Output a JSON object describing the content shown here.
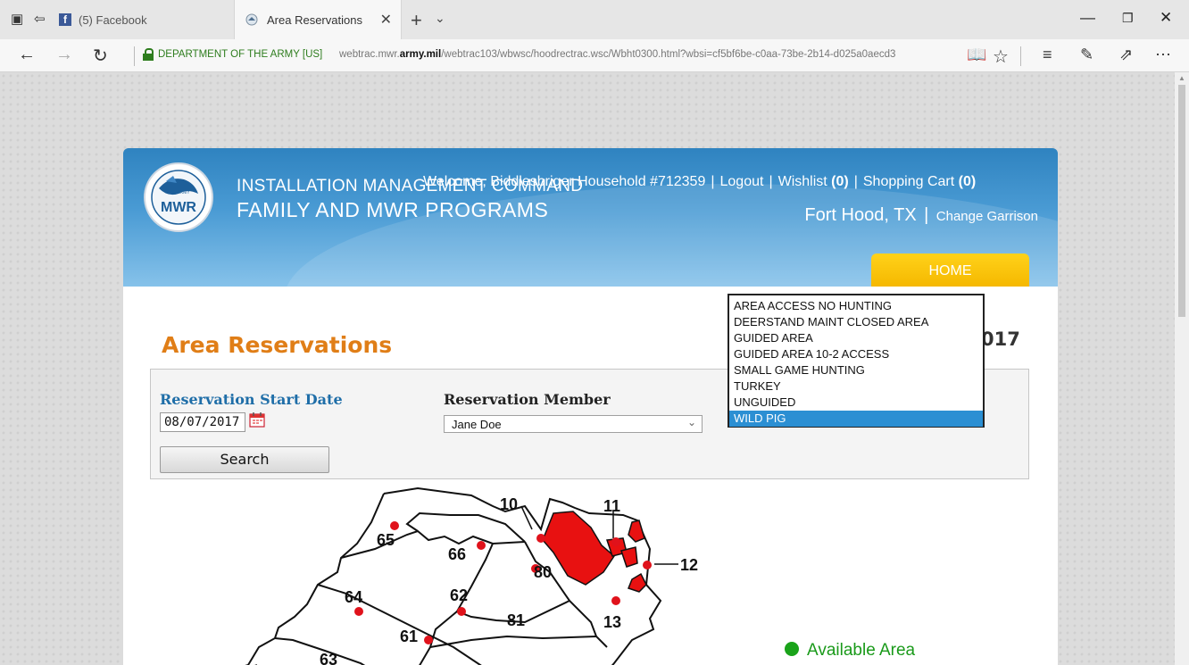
{
  "browser": {
    "tabs": [
      {
        "label": "(5) Facebook"
      },
      {
        "label": "Area Reservations"
      }
    ],
    "address": {
      "cert_name": "DEPARTMENT OF THE ARMY [US]",
      "url_prefix": "webtrac.mwr.",
      "url_domain": "army.mil",
      "url_suffix": "/webtrac103/wbwsc/hoodrectrac.wsc/Wbht0300.html?wbsi=cf5bf6be-c0aa-73be-2b14-d025a0aecd3"
    }
  },
  "header": {
    "logo_text": "MWR",
    "logo_small": "U.S. ARMY",
    "org_line1": "INSTALLATION MANAGEMENT COMMAND",
    "org_line2": "FAMILY AND MWR PROGRAMS",
    "welcome": "Welcome, Biddlesbriger Household #712359",
    "logout": "Logout",
    "wishlist": "Wishlist",
    "wishlist_count": "(0)",
    "cart": "Shopping Cart",
    "cart_count": "(0)",
    "location": "Fort Hood, TX",
    "change_garrison": "Change Garrison",
    "home_tab": "HOME"
  },
  "page": {
    "title": "Area Reservations",
    "date_fragment": "017",
    "start_date_label": "Reservation Start Date",
    "start_date_value": "08/07/2017",
    "member_label": "Reservation Member",
    "member_value": "Jane Doe",
    "search_button": "Search"
  },
  "dropdown": {
    "options": [
      "AREA ACCESS NO HUNTING",
      "DEERSTAND MAINT CLOSED AREA",
      "GUIDED AREA",
      "GUIDED AREA 10-2 ACCESS",
      "SMALL GAME HUNTING",
      "TURKEY",
      "UNGUIDED",
      "WILD PIG"
    ],
    "selected": "WILD PIG"
  },
  "map": {
    "area_labels": [
      "65",
      "66",
      "10",
      "11",
      "12",
      "80",
      "64",
      "62",
      "81",
      "13",
      "61",
      "63"
    ],
    "legend_available": "Available Area",
    "legend_color": "#1aa31a",
    "marker_color": "#e0121b",
    "closed_fill": "#e81111"
  }
}
